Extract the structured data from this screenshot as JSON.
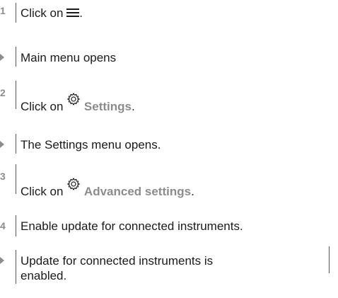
{
  "steps": [
    {
      "marker": "1",
      "text_before": "Click on ",
      "icon": "hamburger-menu-icon",
      "ui_term": "",
      "text_after": "."
    },
    {
      "marker": "result",
      "text": "Main menu opens"
    },
    {
      "marker": "2",
      "text_before": "Click on ",
      "icon": "gear-icon",
      "ui_term": "Settings",
      "text_after": "."
    },
    {
      "marker": "result",
      "text": "The Settings menu opens."
    },
    {
      "marker": "3",
      "text_before": "Click on ",
      "icon": "gear-icon",
      "ui_term": "Advanced settings",
      "text_after": "."
    },
    {
      "marker": "4",
      "text": "Enable update for connected instruments."
    },
    {
      "marker": "result",
      "text": "Update for connected instruments is enabled."
    }
  ],
  "colors": {
    "text": "#1a1a1a",
    "ui_term": "#8c8c8c",
    "marker": "#8c8c8c",
    "rule": "#555555"
  }
}
